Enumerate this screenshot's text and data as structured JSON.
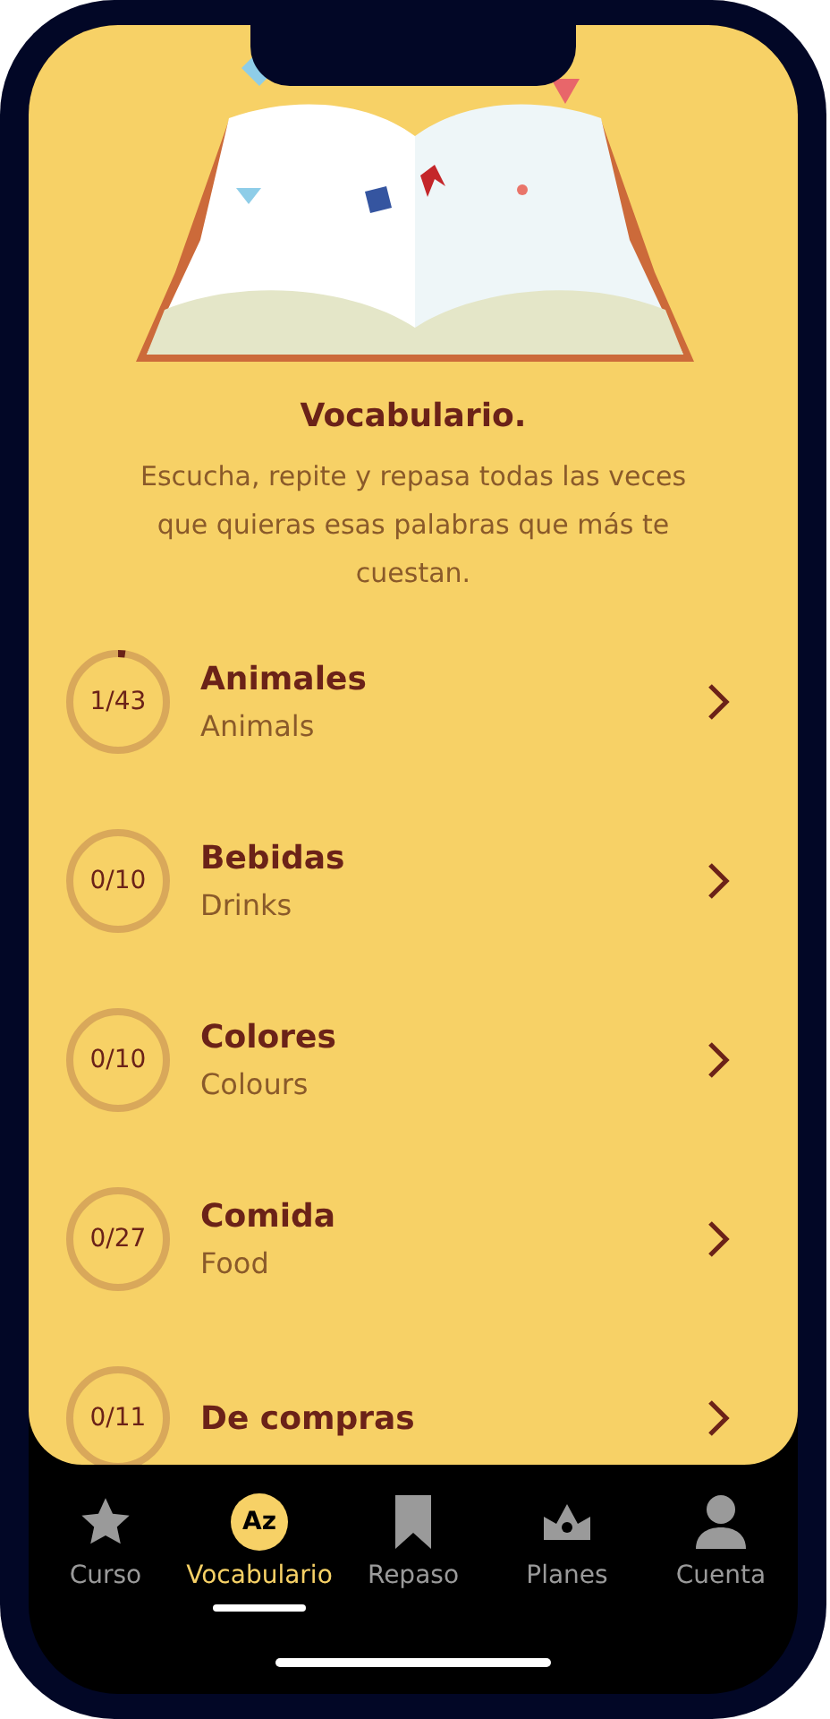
{
  "header": {
    "title": "Vocabulario.",
    "description": "Escucha, repite y repasa todas las veces que quieras esas palabras que más te cuestan."
  },
  "topics": [
    {
      "progress": "1/43",
      "title": "Animales",
      "subtitle": "Animals"
    },
    {
      "progress": "0/10",
      "title": "Bebidas",
      "subtitle": "Drinks"
    },
    {
      "progress": "0/10",
      "title": "Colores",
      "subtitle": "Colours"
    },
    {
      "progress": "0/27",
      "title": "Comida",
      "subtitle": "Food"
    },
    {
      "progress": "0/11",
      "title": "De compras"
    }
  ],
  "tab_bar": [
    {
      "kind": "star",
      "label": "Curso",
      "selected": false
    },
    {
      "kind": "badge",
      "icon_text": "Az",
      "label": "Vocabulario",
      "selected": true
    },
    {
      "kind": "bookmark",
      "label": "Repaso",
      "selected": false
    },
    {
      "kind": "crown",
      "label": "Planes",
      "selected": false
    },
    {
      "kind": "person",
      "label": "Cuenta",
      "selected": false
    }
  ]
}
